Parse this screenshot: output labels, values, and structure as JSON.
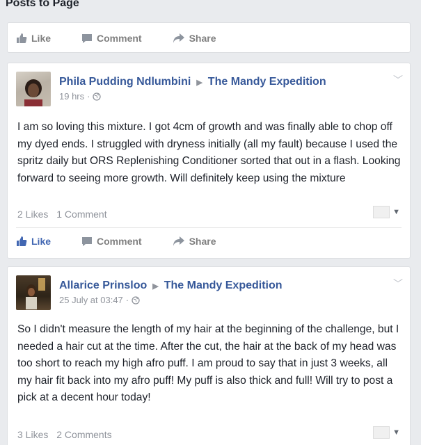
{
  "section": {
    "title": "Posts to Page"
  },
  "actions": {
    "like": "Like",
    "comment": "Comment",
    "share": "Share"
  },
  "posts": [
    {
      "author": "Phila Pudding Ndlumbini",
      "page": "The Mandy Expedition",
      "time": "19 hrs",
      "text": "I am so loving this mixture. I got 4cm of growth and was finally able to chop off my dyed ends. I struggled with dryness initially (all my fault) because I used the spritz daily but ORS Replenishing Conditioner sorted that out in a flash. Looking forward to seeing more growth. Will definitely keep using the mixture",
      "likes": "2 Likes",
      "comments": "1 Comment"
    },
    {
      "author": "Allarice Prinsloo",
      "page": "The Mandy Expedition",
      "time": "25 July at 03:47",
      "text": "So I didn't measure the length of my hair at the beginning of the challenge, but I needed a hair cut at the time. After the cut, the hair at the back of my head was too short to reach my high afro puff. I am proud to say that in just 3 weeks, all my hair fit back into my afro puff! My puff is also thick and full! Will try to post a pick at a decent hour today!",
      "likes": "3 Likes",
      "comments": "2 Comments"
    }
  ]
}
